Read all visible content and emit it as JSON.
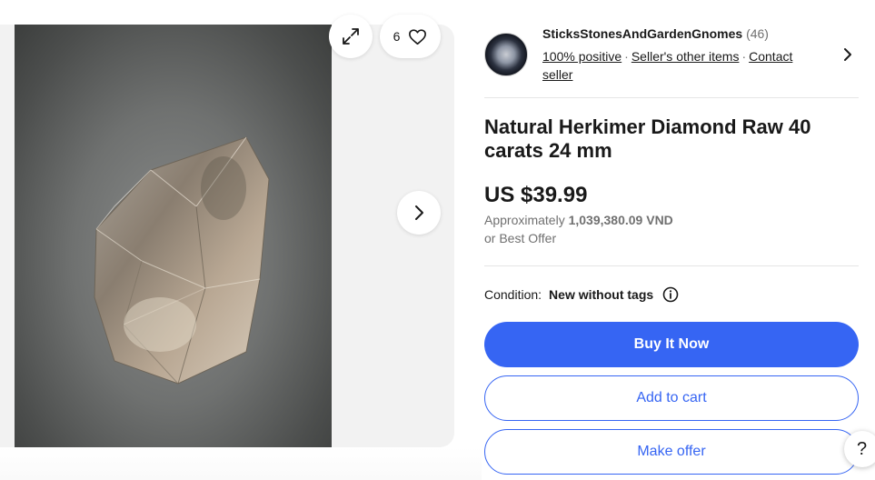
{
  "gallery": {
    "image_alt": "Natural Herkimer Diamond crystal",
    "watch_count": "6",
    "icons": {
      "expand": "expand-icon",
      "heart": "heart-icon",
      "next": "chevron-right-icon"
    }
  },
  "seller": {
    "name": "SticksStonesAndGardenGnomes",
    "feedback_count": "(46)",
    "positive": "100% positive",
    "other_items": "Seller's other items",
    "contact": "Contact seller",
    "separator": "·"
  },
  "listing": {
    "title": "Natural Herkimer Diamond Raw 40 carats 24 mm",
    "price": "US $39.99",
    "approx_label": "Approximately",
    "approx_value": "1,039,380.09 VND",
    "best_offer": "or Best Offer",
    "condition_label": "Condition:",
    "condition_value": "New without tags"
  },
  "actions": {
    "buy_now": "Buy It Now",
    "add_to_cart": "Add to cart",
    "make_offer": "Make offer"
  },
  "help": {
    "label": "?"
  },
  "colors": {
    "accent": "#3665f3",
    "text": "#191919",
    "muted": "#707070"
  }
}
